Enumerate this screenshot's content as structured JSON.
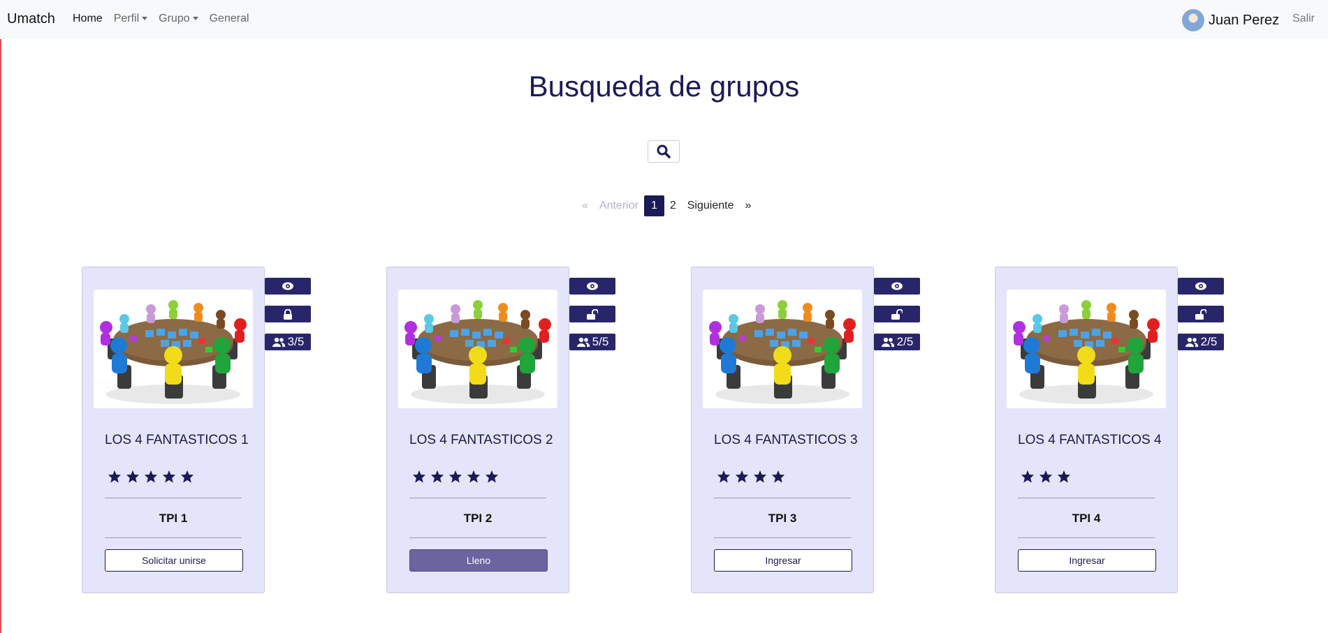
{
  "nav": {
    "brand": "Umatch",
    "links": [
      "Home",
      "Perfil",
      "Grupo",
      "General"
    ],
    "user_name": "Juan Perez",
    "logout": "Salir"
  },
  "page": {
    "title": "Busqueda de grupos"
  },
  "pagination": {
    "prev_symbol": "«",
    "prev": "Anterior",
    "pages": [
      "1",
      "2"
    ],
    "current": "1",
    "next": "Siguiente",
    "next_symbol": "»"
  },
  "cards": [
    {
      "title": "LOS 4 FANTASTICOS 1",
      "rating": 5,
      "project": "TPI 1",
      "button": "Solicitar unirse",
      "members": "3/5",
      "lock": "locked",
      "button_state": "normal"
    },
    {
      "title": "LOS 4 FANTASTICOS 2",
      "rating": 5,
      "project": "TPI 2",
      "button": "Lleno",
      "members": "5/5",
      "lock": "unlocked",
      "button_state": "full"
    },
    {
      "title": "LOS 4 FANTASTICOS 3",
      "rating": 4,
      "project": "TPI 3",
      "button": "Ingresar",
      "members": "2/5",
      "lock": "unlocked",
      "button_state": "normal"
    },
    {
      "title": "LOS 4 FANTASTICOS 4",
      "rating": 3,
      "project": "TPI 4",
      "button": "Ingresar",
      "members": "2/5",
      "lock": "unlocked",
      "button_state": "normal"
    }
  ],
  "icons": {
    "view": "eye-icon",
    "lock": "lock-icon",
    "unlock": "unlock-icon",
    "members": "users-icon",
    "search": "search-icon",
    "rating": "star-icon"
  },
  "colors": {
    "primary": "#1b1a57",
    "card_bg": "#e4e4fb",
    "badge_bg": "#29256b",
    "full_button": "#6a649f"
  }
}
